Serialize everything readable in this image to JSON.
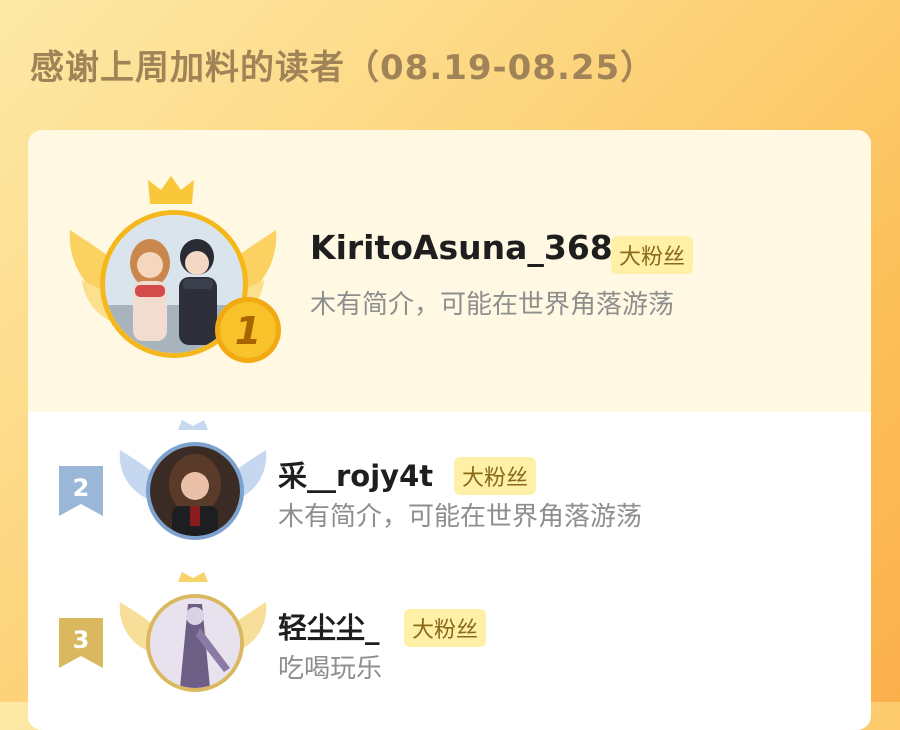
{
  "header": {
    "title": "感谢上周加料的读者（08.19-08.25）"
  },
  "readers": [
    {
      "rank": "1",
      "name": "KiritoAsuna_368",
      "badge": "大粉丝",
      "bio": "木有简介，可能在世界角落游荡"
    },
    {
      "rank": "2",
      "name": "采__rojy4t",
      "badge": "大粉丝",
      "bio": "木有简介，可能在世界角落游荡"
    },
    {
      "rank": "3",
      "name": "轻尘尘_",
      "badge": "大粉丝",
      "bio": "吃喝玩乐"
    }
  ],
  "colors": {
    "gold": "#f5b81c",
    "silver": "#9bb7d8",
    "bronze": "#d9b860",
    "badge_bg": "#fff0a8"
  }
}
